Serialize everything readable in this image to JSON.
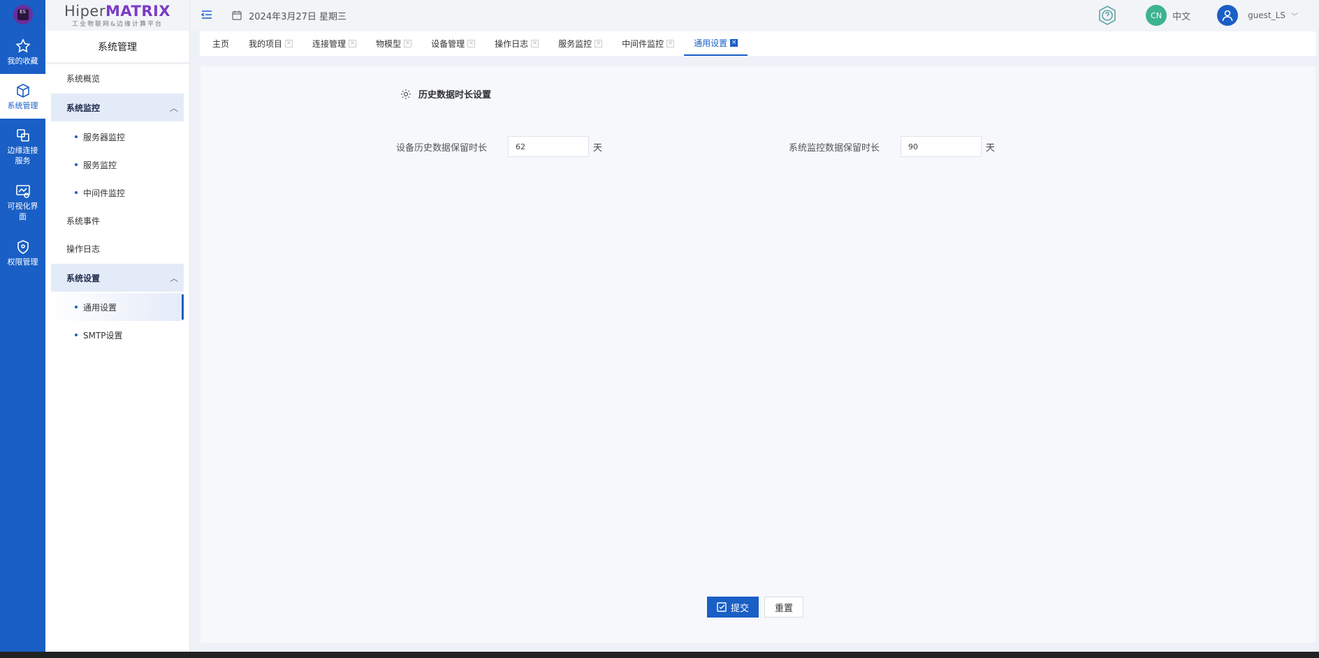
{
  "rail": {
    "items": [
      {
        "label": "我的收藏",
        "icon": "star-icon"
      },
      {
        "label": "系统管理",
        "icon": "cube-icon"
      },
      {
        "label": "边缘连接服务",
        "icon": "link-icon"
      },
      {
        "label": "可视化界面",
        "icon": "visual-icon"
      },
      {
        "label": "权限管理",
        "icon": "shield-icon"
      }
    ],
    "logo_text": "ES"
  },
  "brand": {
    "name_a": "Hiper",
    "name_b": "MATRIX",
    "subtitle": "工业物联网&边缘计算平台"
  },
  "sidebar": {
    "title": "系统管理",
    "items": [
      {
        "label": "系统概览"
      },
      {
        "label": "系统监控"
      },
      {
        "label": "服务器监控"
      },
      {
        "label": "服务监控"
      },
      {
        "label": "中间件监控"
      },
      {
        "label": "系统事件"
      },
      {
        "label": "操作日志"
      },
      {
        "label": "系统设置"
      },
      {
        "label": "通用设置"
      },
      {
        "label": "SMTP设置"
      }
    ]
  },
  "header": {
    "date": "2024年3月27日 星期三",
    "lang_badge": "CN",
    "lang_label": "中文",
    "username": "guest_LS"
  },
  "tabs": [
    {
      "label": "主页"
    },
    {
      "label": "我的项目"
    },
    {
      "label": "连接管理"
    },
    {
      "label": "物模型"
    },
    {
      "label": "设备管理"
    },
    {
      "label": "操作日志"
    },
    {
      "label": "服务监控"
    },
    {
      "label": "中间件监控"
    },
    {
      "label": "通用设置"
    }
  ],
  "form": {
    "section_title": "历史数据时长设置",
    "device_history_label": "设备历史数据保留时长",
    "device_history_value": "62",
    "monitor_history_label": "系统监控数据保留时长",
    "monitor_history_value": "90",
    "unit": "天"
  },
  "buttons": {
    "submit": "提交",
    "reset": "重置"
  },
  "colors": {
    "primary": "#1a5fc5",
    "brand_purple": "#7c3bc4",
    "lang_badge": "#3db38f"
  }
}
